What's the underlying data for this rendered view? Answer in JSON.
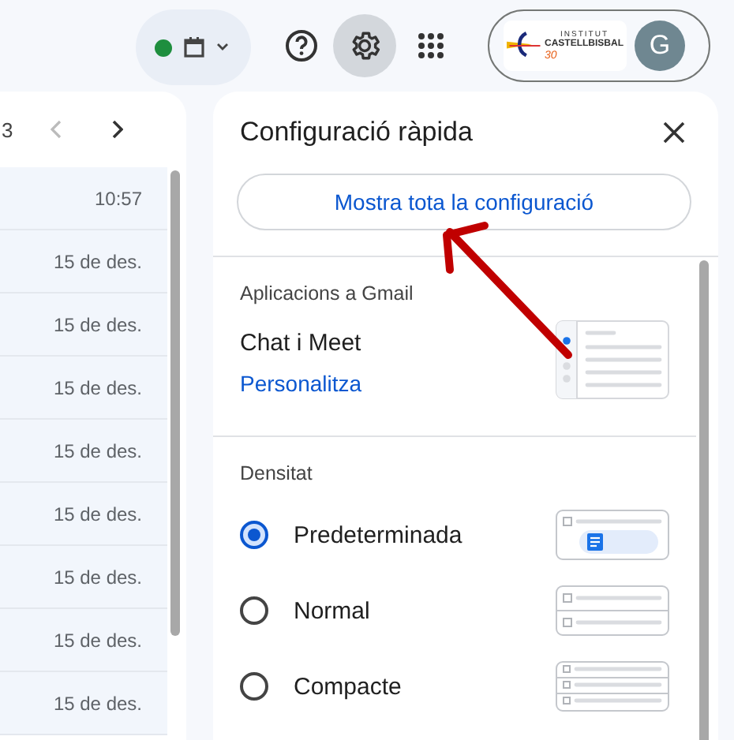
{
  "top_bar": {
    "status_online": true,
    "logo": {
      "line_1": "INSTITUT",
      "line_2": "CASTELLBISBAL",
      "line_3": "30"
    },
    "avatar": "G"
  },
  "mail_list": {
    "page_info": "3",
    "rows": [
      {
        "time": "10:57"
      },
      {
        "time": "15 de des."
      },
      {
        "time": "15 de des."
      },
      {
        "time": "15 de des."
      },
      {
        "time": "15 de des."
      },
      {
        "time": "15 de des."
      },
      {
        "time": "15 de des."
      },
      {
        "time": "15 de des."
      },
      {
        "time": "15 de des."
      }
    ]
  },
  "quick_settings": {
    "title": "Configuració ràpida",
    "all_settings_button": "Mostra tota la configuració",
    "apps_section": {
      "heading": "Aplicacions a Gmail",
      "label": "Chat i Meet",
      "link": "Personalitza"
    },
    "density_section": {
      "heading": "Densitat",
      "options": [
        {
          "label": "Predeterminada",
          "selected": true
        },
        {
          "label": "Normal",
          "selected": false
        },
        {
          "label": "Compacte",
          "selected": false
        }
      ]
    }
  }
}
